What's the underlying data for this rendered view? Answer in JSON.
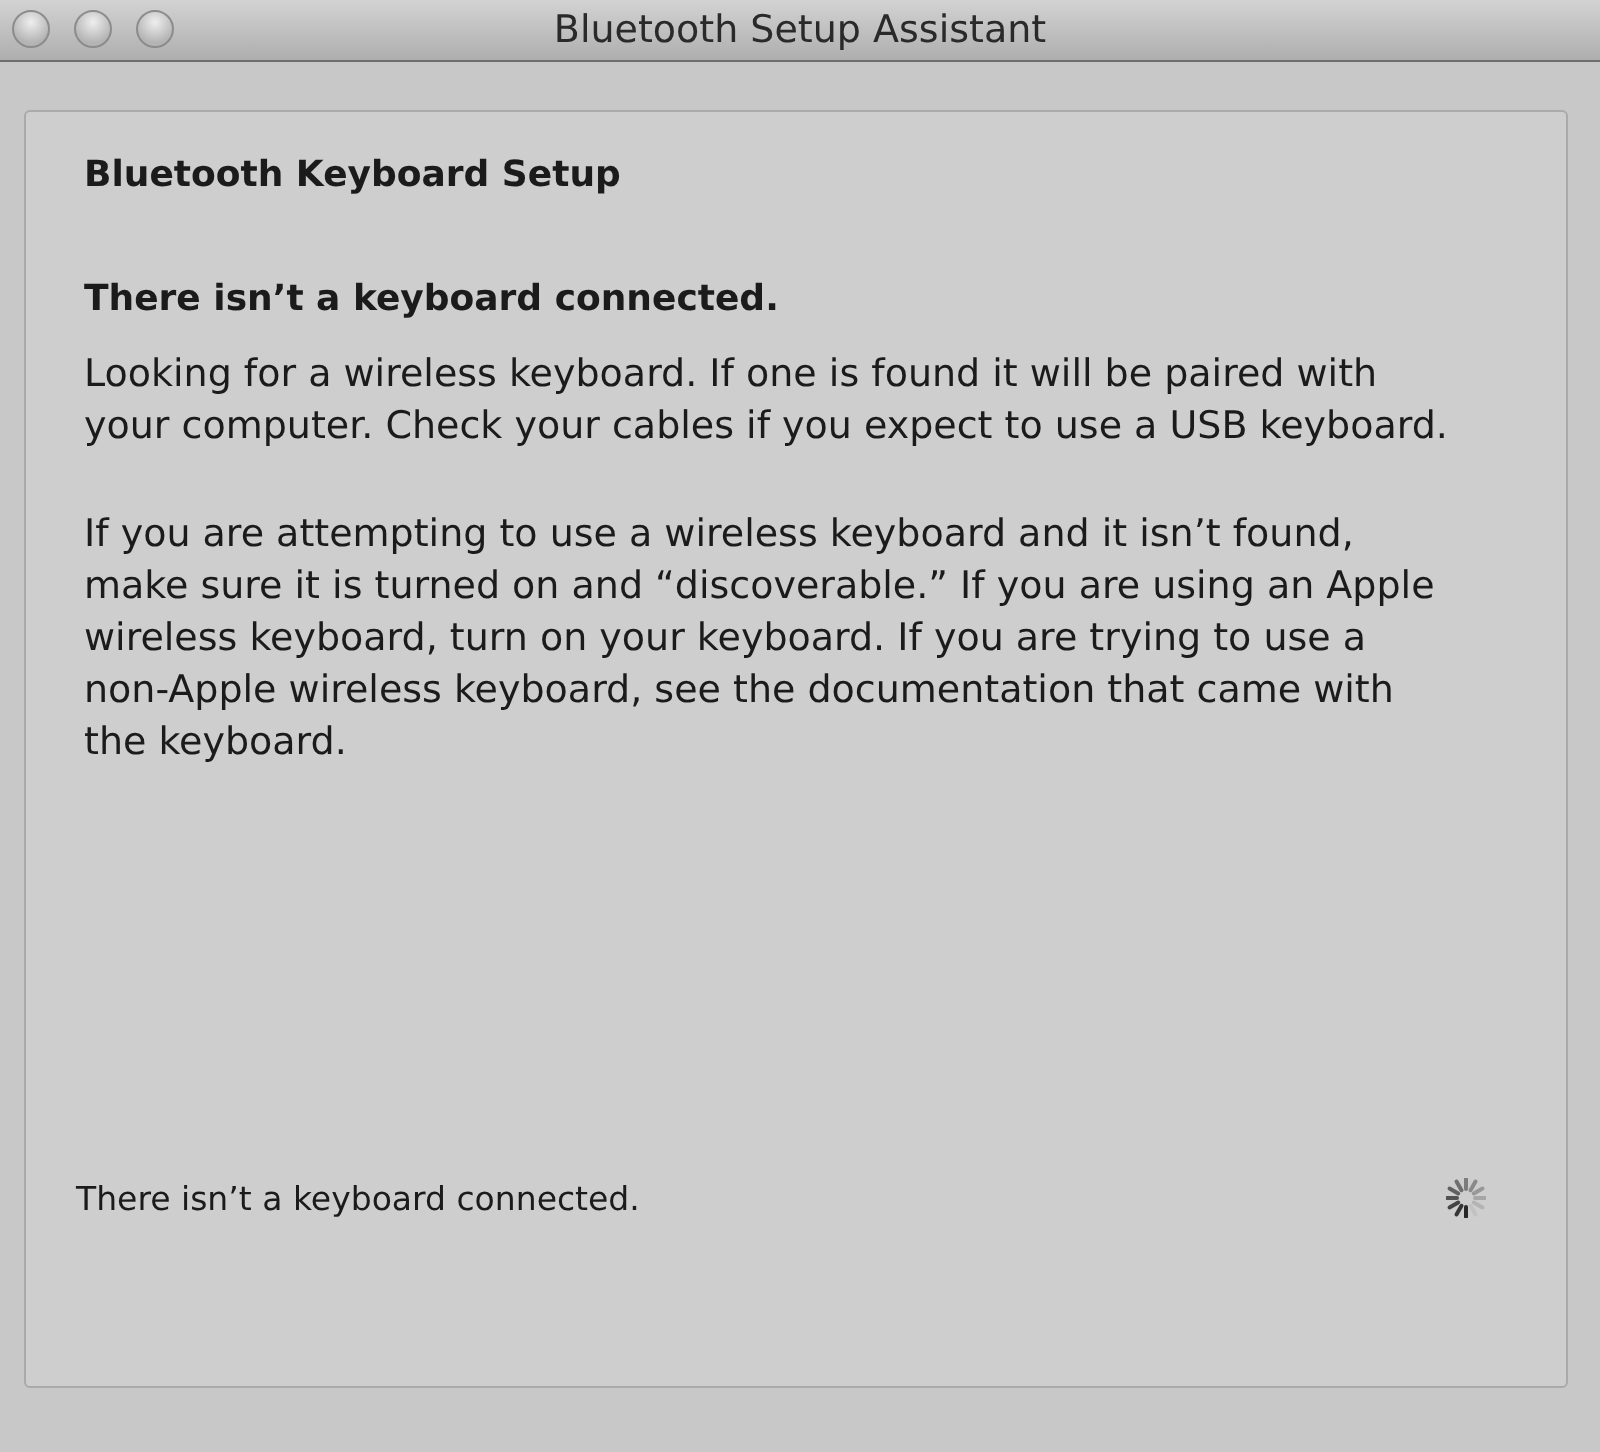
{
  "window": {
    "title": "Bluetooth Setup Assistant"
  },
  "panel": {
    "heading": "Bluetooth Keyboard Setup",
    "subheading": "There isn’t a keyboard connected.",
    "paragraphs": [
      "Looking for a wireless keyboard. If one is found it will be paired with your computer. Check your cables if you expect to use a USB keyboard.",
      "If you are attempting to use a wireless keyboard and it isn’t found, make sure it is turned on and “discoverable.” If you are using an Apple wireless keyboard, turn on your keyboard. If you are trying to use a non-Apple wireless keyboard, see the documentation that came with the keyboard."
    ]
  },
  "status": {
    "text": "There isn’t a keyboard connected.",
    "searching": true
  }
}
